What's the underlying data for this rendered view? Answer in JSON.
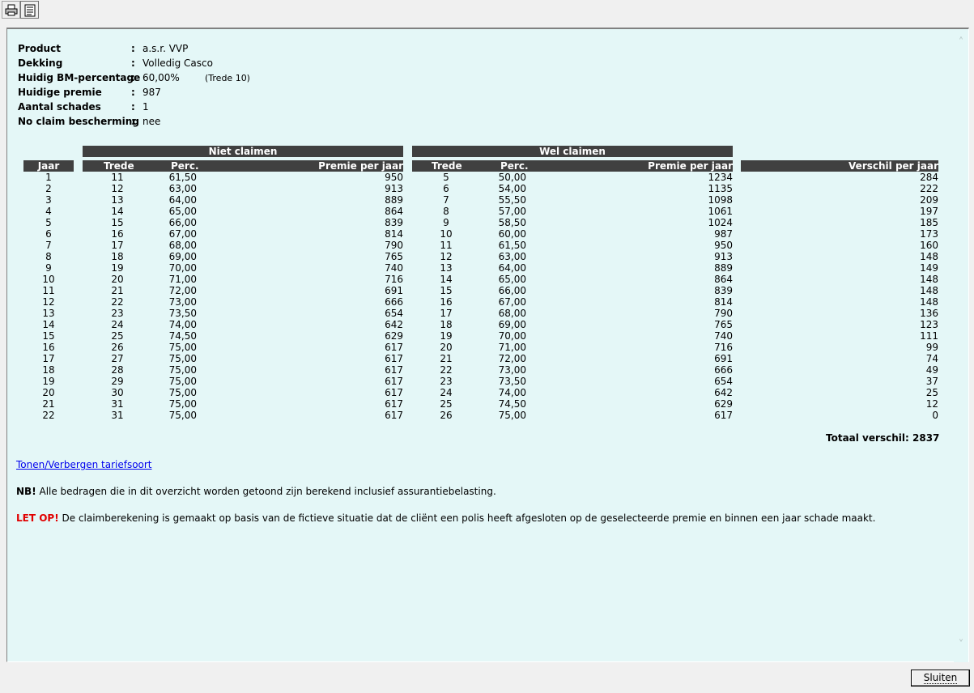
{
  "toolbar": {
    "print_icon": "printer-icon",
    "list_icon": "document-list-icon"
  },
  "info": [
    {
      "label": "Product",
      "value": "a.s.r. VVP",
      "extra": ""
    },
    {
      "label": "Dekking",
      "value": "Volledig Casco",
      "extra": ""
    },
    {
      "label": "Huidig BM-percentage",
      "value": "60,00%",
      "extra": "(Trede 10)"
    },
    {
      "label": "Huidige premie",
      "value": "987",
      "extra": ""
    },
    {
      "label": "Aantal schades",
      "value": "1",
      "extra": ""
    },
    {
      "label": "No claim bescherming",
      "value": "nee",
      "extra": ""
    }
  ],
  "table": {
    "group_niet": "Niet claimen",
    "group_wel": "Wel claimen",
    "headers": {
      "jaar": "Jaar",
      "trede": "Trede",
      "perc": "Perc.",
      "premie": "Premie per jaar",
      "verschil": "Verschil per jaar"
    },
    "rows": [
      {
        "jaar": "1",
        "n_trede": "11",
        "n_perc": "61,50",
        "n_premie": "950",
        "w_trede": "5",
        "w_perc": "50,00",
        "w_premie": "1234",
        "verschil": "284"
      },
      {
        "jaar": "2",
        "n_trede": "12",
        "n_perc": "63,00",
        "n_premie": "913",
        "w_trede": "6",
        "w_perc": "54,00",
        "w_premie": "1135",
        "verschil": "222"
      },
      {
        "jaar": "3",
        "n_trede": "13",
        "n_perc": "64,00",
        "n_premie": "889",
        "w_trede": "7",
        "w_perc": "55,50",
        "w_premie": "1098",
        "verschil": "209"
      },
      {
        "jaar": "4",
        "n_trede": "14",
        "n_perc": "65,00",
        "n_premie": "864",
        "w_trede": "8",
        "w_perc": "57,00",
        "w_premie": "1061",
        "verschil": "197"
      },
      {
        "jaar": "5",
        "n_trede": "15",
        "n_perc": "66,00",
        "n_premie": "839",
        "w_trede": "9",
        "w_perc": "58,50",
        "w_premie": "1024",
        "verschil": "185"
      },
      {
        "jaar": "6",
        "n_trede": "16",
        "n_perc": "67,00",
        "n_premie": "814",
        "w_trede": "10",
        "w_perc": "60,00",
        "w_premie": "987",
        "verschil": "173"
      },
      {
        "jaar": "7",
        "n_trede": "17",
        "n_perc": "68,00",
        "n_premie": "790",
        "w_trede": "11",
        "w_perc": "61,50",
        "w_premie": "950",
        "verschil": "160"
      },
      {
        "jaar": "8",
        "n_trede": "18",
        "n_perc": "69,00",
        "n_premie": "765",
        "w_trede": "12",
        "w_perc": "63,00",
        "w_premie": "913",
        "verschil": "148"
      },
      {
        "jaar": "9",
        "n_trede": "19",
        "n_perc": "70,00",
        "n_premie": "740",
        "w_trede": "13",
        "w_perc": "64,00",
        "w_premie": "889",
        "verschil": "149"
      },
      {
        "jaar": "10",
        "n_trede": "20",
        "n_perc": "71,00",
        "n_premie": "716",
        "w_trede": "14",
        "w_perc": "65,00",
        "w_premie": "864",
        "verschil": "148"
      },
      {
        "jaar": "11",
        "n_trede": "21",
        "n_perc": "72,00",
        "n_premie": "691",
        "w_trede": "15",
        "w_perc": "66,00",
        "w_premie": "839",
        "verschil": "148"
      },
      {
        "jaar": "12",
        "n_trede": "22",
        "n_perc": "73,00",
        "n_premie": "666",
        "w_trede": "16",
        "w_perc": "67,00",
        "w_premie": "814",
        "verschil": "148"
      },
      {
        "jaar": "13",
        "n_trede": "23",
        "n_perc": "73,50",
        "n_premie": "654",
        "w_trede": "17",
        "w_perc": "68,00",
        "w_premie": "790",
        "verschil": "136"
      },
      {
        "jaar": "14",
        "n_trede": "24",
        "n_perc": "74,00",
        "n_premie": "642",
        "w_trede": "18",
        "w_perc": "69,00",
        "w_premie": "765",
        "verschil": "123"
      },
      {
        "jaar": "15",
        "n_trede": "25",
        "n_perc": "74,50",
        "n_premie": "629",
        "w_trede": "19",
        "w_perc": "70,00",
        "w_premie": "740",
        "verschil": "111"
      },
      {
        "jaar": "16",
        "n_trede": "26",
        "n_perc": "75,00",
        "n_premie": "617",
        "w_trede": "20",
        "w_perc": "71,00",
        "w_premie": "716",
        "verschil": "99"
      },
      {
        "jaar": "17",
        "n_trede": "27",
        "n_perc": "75,00",
        "n_premie": "617",
        "w_trede": "21",
        "w_perc": "72,00",
        "w_premie": "691",
        "verschil": "74"
      },
      {
        "jaar": "18",
        "n_trede": "28",
        "n_perc": "75,00",
        "n_premie": "617",
        "w_trede": "22",
        "w_perc": "73,00",
        "w_premie": "666",
        "verschil": "49"
      },
      {
        "jaar": "19",
        "n_trede": "29",
        "n_perc": "75,00",
        "n_premie": "617",
        "w_trede": "23",
        "w_perc": "73,50",
        "w_premie": "654",
        "verschil": "37"
      },
      {
        "jaar": "20",
        "n_trede": "30",
        "n_perc": "75,00",
        "n_premie": "617",
        "w_trede": "24",
        "w_perc": "74,00",
        "w_premie": "642",
        "verschil": "25"
      },
      {
        "jaar": "21",
        "n_trede": "31",
        "n_perc": "75,00",
        "n_premie": "617",
        "w_trede": "25",
        "w_perc": "74,50",
        "w_premie": "629",
        "verschil": "12"
      },
      {
        "jaar": "22",
        "n_trede": "31",
        "n_perc": "75,00",
        "n_premie": "617",
        "w_trede": "26",
        "w_perc": "75,00",
        "w_premie": "617",
        "verschil": "0"
      }
    ],
    "total_label": "Totaal verschil:",
    "total_value": "2837"
  },
  "toggle_link": "Tonen/Verbergen tariefsoort",
  "notes": {
    "nb_prefix": "NB!",
    "nb_text": " Alle bedragen die in dit overzicht worden getoond zijn berekend inclusief assurantiebelasting.",
    "letop_prefix": "LET OP!",
    "letop_text": " De claimberekening is gemaakt op basis van de fictieve situatie dat de cliënt een polis heeft afgesloten op de geselecteerde premie en binnen een jaar schade maakt."
  },
  "close_button": "Sluiten"
}
